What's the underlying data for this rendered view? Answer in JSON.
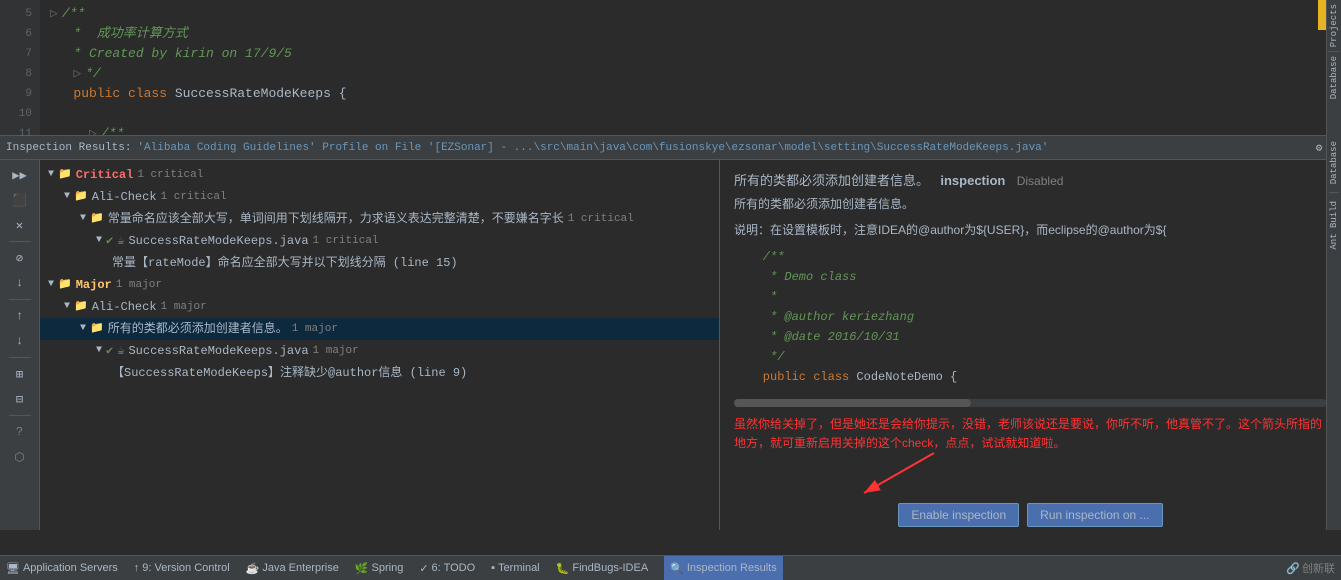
{
  "editor": {
    "lines": [
      {
        "num": "5",
        "content": "/**",
        "class": "c-comment"
      },
      {
        "num": "6",
        "content": " *  成功率计算方式",
        "class": "c-comment"
      },
      {
        "num": "7",
        "content": " * Created by kirin on 17/9/5",
        "class": "c-comment"
      },
      {
        "num": "8",
        "content": " */",
        "class": "c-comment"
      },
      {
        "num": "9",
        "content": " public class SuccessRateModeKeeps {",
        "class": "c-class"
      },
      {
        "num": "10",
        "content": "",
        "class": ""
      },
      {
        "num": "11",
        "content": "    /**",
        "class": "c-comment"
      }
    ]
  },
  "inspection_bar": {
    "label": "Inspection Results:",
    "profile": "'Alibaba Coding Guidelines' Profile on File '[EZSonar] - ...\\src\\main\\java\\com\\fusionskye\\ezsonar\\model\\setting\\SuccessRateModeKeeps.java'",
    "settings_icon": "⚙",
    "export_icon": "↓"
  },
  "tree": {
    "items": [
      {
        "indent": 1,
        "icon": "folder",
        "severity": "critical",
        "label": "Critical",
        "count": "1 critical",
        "expanded": true
      },
      {
        "indent": 2,
        "icon": "folder",
        "label": "Ali-Check",
        "count": "1 critical",
        "expanded": true
      },
      {
        "indent": 3,
        "icon": "folder",
        "label": "常量命名应该全部大写，单词间用下划线隔开，力求语义表达完整清楚，不要嫌名字长",
        "count": "1 critical",
        "expanded": true
      },
      {
        "indent": 4,
        "icon": "file",
        "label": "SuccessRateModeKeeps.java",
        "count": "1 critical",
        "expanded": true
      },
      {
        "indent": 5,
        "icon": "none",
        "label": "常量【rateMode】命名应全部大写并以下划线分隔 (line 15)",
        "count": ""
      },
      {
        "indent": 1,
        "icon": "folder",
        "severity": "major",
        "label": "Major",
        "count": "1 major",
        "expanded": true
      },
      {
        "indent": 2,
        "icon": "folder",
        "label": "Ali-Check",
        "count": "1 major",
        "expanded": true
      },
      {
        "indent": 3,
        "icon": "file",
        "label": "所有的类都必须添加创建者信息。",
        "count": "1 major",
        "expanded": true,
        "selected": true
      },
      {
        "indent": 4,
        "icon": "file",
        "label": "SuccessRateModeKeeps.java",
        "count": "1 major",
        "expanded": true
      },
      {
        "indent": 5,
        "icon": "none",
        "label": "【SuccessRateModeKeeps】注释缺少@author信息 (line 9)",
        "count": ""
      }
    ]
  },
  "detail": {
    "title": "所有的类都必须添加创建者信息。",
    "keyword": "inspection",
    "status": "Disabled",
    "description": "所有的类都必须添加创建者信息。",
    "explanation_prefix": "说明：在设置模板时，注意IDEA的@author为${USER}，而eclipse的@author为${",
    "code_lines": [
      {
        "text": "    /**",
        "class": "code-green"
      },
      {
        "text": "     * Demo class",
        "class": "code-green"
      },
      {
        "text": "     *",
        "class": "code-green"
      },
      {
        "text": "     * @author keriezhang",
        "class": "code-green"
      },
      {
        "text": "     * @date 2016/10/31",
        "class": "code-green"
      },
      {
        "text": "     */",
        "class": "code-green"
      },
      {
        "text": "    public class CodeNoteDemo {",
        "class": ""
      }
    ],
    "annotation": "虽然你给关掉了，但是她还是会给你提示，没错，老师该说还是要说，你听不听，他真管不了。这个箭头所指的地方，就可重新启用关掉的这个check，点点，试试就知道啦。"
  },
  "buttons": {
    "enable_inspection": "Enable inspection",
    "run_inspection": "Run inspection on ..."
  },
  "status_bar": {
    "items": [
      {
        "icon": "🖥",
        "label": "Application Servers"
      },
      {
        "icon": "↑",
        "label": "9: Version Control"
      },
      {
        "icon": "☕",
        "label": "Java Enterprise"
      },
      {
        "icon": "🌿",
        "label": "Spring"
      },
      {
        "icon": "✓",
        "label": "6: TODO"
      },
      {
        "icon": "▪",
        "label": "Terminal"
      },
      {
        "icon": "🐛",
        "label": "FindBugs-IDEA"
      },
      {
        "icon": "🔍",
        "label": "Inspection Results",
        "active": true
      }
    ],
    "watermark": "创新联"
  },
  "sidebar_tabs": [
    {
      "label": "Projects"
    },
    {
      "label": "Database"
    },
    {
      "label": "Ant Build"
    }
  ],
  "toolbar_buttons": [
    {
      "icon": "▶▶",
      "name": "rerun"
    },
    {
      "icon": "⬛",
      "name": "stop"
    },
    {
      "icon": "✕",
      "name": "close"
    },
    {
      "icon": "⬡",
      "name": "filter"
    },
    {
      "icon": "↑",
      "name": "prev"
    },
    {
      "icon": "↓",
      "name": "next"
    },
    {
      "icon": "⊞",
      "name": "expand"
    },
    {
      "icon": "⊟",
      "name": "collapse"
    },
    {
      "icon": "?",
      "name": "help"
    }
  ]
}
